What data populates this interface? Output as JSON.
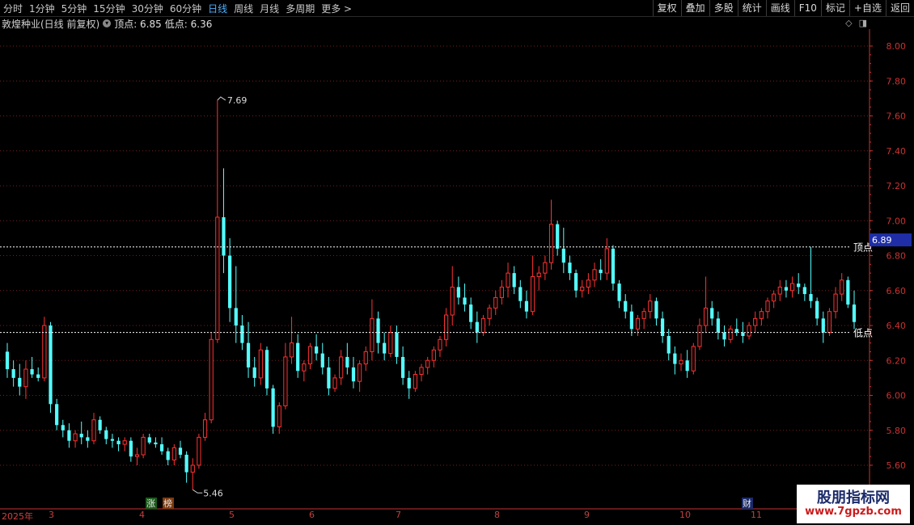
{
  "toolbar": {
    "periods": [
      "分时",
      "1分钟",
      "5分钟",
      "15分钟",
      "30分钟",
      "60分钟",
      "日线",
      "周线",
      "月线",
      "多周期",
      "更多 >"
    ],
    "active": "日线",
    "tools": [
      "复权",
      "叠加",
      "多股",
      "统计",
      "画线",
      "F10",
      "标记",
      "+自选",
      "返回"
    ]
  },
  "info": {
    "title": "敦煌种业(日线 前复权)",
    "dot_icon": "menu-dot-icon",
    "top_label": "顶点: 6.85",
    "low_label": "低点: 6.36"
  },
  "colors": {
    "up": "#ff3232",
    "down": "#54ffff",
    "grid": "#7a1e1e",
    "axis": "#c83232",
    "level_line": "#ffffff",
    "price_tag": "#1f2ea6"
  },
  "chart_data": {
    "type": "candlestick",
    "title": "敦煌种业(日线 前复权)",
    "ylim": [
      5.5,
      8.1
    ],
    "yticks": [
      "8.00",
      "7.80",
      "7.60",
      "7.40",
      "7.20",
      "7.00",
      "6.80",
      "6.60",
      "6.40",
      "6.20",
      "6.00",
      "5.80",
      "5.60"
    ],
    "x_labels": [
      "2025年",
      "3",
      "4",
      "5",
      "6",
      "7",
      "8",
      "9",
      "10",
      "11"
    ],
    "levels": [
      {
        "name": "顶点",
        "value": 6.85
      },
      {
        "name": "低点",
        "value": 6.36
      }
    ],
    "current_price": "6.89",
    "annotations": [
      {
        "text": "7.69",
        "value": 7.69
      },
      {
        "text": "5.46",
        "value": 5.46
      }
    ],
    "markers": [
      "涨",
      "榜",
      "财"
    ],
    "ohlc": [
      [
        6.25,
        6.3,
        6.1,
        6.15
      ],
      [
        6.15,
        6.2,
        6.05,
        6.1
      ],
      [
        6.1,
        6.18,
        6.0,
        6.05
      ],
      [
        6.05,
        6.2,
        5.98,
        6.15
      ],
      [
        6.15,
        6.22,
        6.1,
        6.12
      ],
      [
        6.12,
        6.16,
        6.08,
        6.1
      ],
      [
        6.1,
        6.45,
        6.08,
        6.4
      ],
      [
        6.4,
        6.42,
        5.9,
        5.95
      ],
      [
        5.95,
        5.98,
        5.8,
        5.83
      ],
      [
        5.83,
        5.86,
        5.76,
        5.8
      ],
      [
        5.8,
        5.84,
        5.7,
        5.74
      ],
      [
        5.74,
        5.8,
        5.7,
        5.78
      ],
      [
        5.78,
        5.85,
        5.72,
        5.76
      ],
      [
        5.76,
        5.8,
        5.7,
        5.74
      ],
      [
        5.74,
        5.9,
        5.72,
        5.86
      ],
      [
        5.86,
        5.88,
        5.78,
        5.8
      ],
      [
        5.8,
        5.82,
        5.72,
        5.75
      ],
      [
        5.75,
        5.78,
        5.7,
        5.74
      ],
      [
        5.74,
        5.76,
        5.68,
        5.72
      ],
      [
        5.72,
        5.76,
        5.68,
        5.74
      ],
      [
        5.74,
        5.76,
        5.62,
        5.65
      ],
      [
        5.65,
        5.7,
        5.6,
        5.66
      ],
      [
        5.66,
        5.78,
        5.64,
        5.76
      ],
      [
        5.76,
        5.78,
        5.72,
        5.73
      ],
      [
        5.73,
        5.76,
        5.7,
        5.72
      ],
      [
        5.72,
        5.76,
        5.66,
        5.68
      ],
      [
        5.68,
        5.7,
        5.6,
        5.63
      ],
      [
        5.63,
        5.72,
        5.6,
        5.7
      ],
      [
        5.7,
        5.74,
        5.64,
        5.66
      ],
      [
        5.66,
        5.68,
        5.5,
        5.56
      ],
      [
        5.56,
        5.64,
        5.46,
        5.6
      ],
      [
        5.6,
        5.78,
        5.58,
        5.76
      ],
      [
        5.76,
        5.9,
        5.74,
        5.86
      ],
      [
        5.86,
        6.36,
        5.84,
        6.32
      ],
      [
        6.32,
        7.69,
        6.3,
        7.02
      ],
      [
        7.02,
        7.3,
        6.7,
        6.8
      ],
      [
        6.8,
        6.9,
        6.42,
        6.5
      ],
      [
        6.5,
        6.74,
        6.3,
        6.4
      ],
      [
        6.4,
        6.46,
        6.26,
        6.3
      ],
      [
        6.3,
        6.42,
        6.1,
        6.16
      ],
      [
        6.16,
        6.22,
        6.05,
        6.1
      ],
      [
        6.1,
        6.3,
        6.06,
        6.26
      ],
      [
        6.26,
        6.28,
        6.0,
        6.04
      ],
      [
        6.04,
        6.06,
        5.78,
        5.82
      ],
      [
        5.82,
        5.96,
        5.78,
        5.94
      ],
      [
        5.94,
        6.3,
        5.92,
        6.22
      ],
      [
        6.22,
        6.45,
        6.18,
        6.3
      ],
      [
        6.3,
        6.35,
        6.1,
        6.14
      ],
      [
        6.14,
        6.2,
        6.08,
        6.18
      ],
      [
        6.18,
        6.3,
        6.15,
        6.28
      ],
      [
        6.28,
        6.35,
        6.2,
        6.24
      ],
      [
        6.24,
        6.3,
        6.12,
        6.16
      ],
      [
        6.16,
        6.22,
        6.0,
        6.04
      ],
      [
        6.04,
        6.12,
        6.02,
        6.1
      ],
      [
        6.1,
        6.26,
        6.06,
        6.22
      ],
      [
        6.22,
        6.3,
        6.12,
        6.16
      ],
      [
        6.16,
        6.22,
        6.04,
        6.08
      ],
      [
        6.08,
        6.2,
        6.02,
        6.18
      ],
      [
        6.18,
        6.28,
        6.14,
        6.25
      ],
      [
        6.25,
        6.55,
        6.2,
        6.44
      ],
      [
        6.44,
        6.48,
        6.24,
        6.3
      ],
      [
        6.3,
        6.36,
        6.2,
        6.24
      ],
      [
        6.24,
        6.4,
        6.22,
        6.36
      ],
      [
        6.36,
        6.4,
        6.18,
        6.22
      ],
      [
        6.22,
        6.28,
        6.06,
        6.1
      ],
      [
        6.1,
        6.14,
        5.98,
        6.04
      ],
      [
        6.04,
        6.14,
        6.02,
        6.12
      ],
      [
        6.12,
        6.18,
        6.08,
        6.16
      ],
      [
        6.16,
        6.22,
        6.12,
        6.2
      ],
      [
        6.2,
        6.28,
        6.16,
        6.26
      ],
      [
        6.26,
        6.34,
        6.22,
        6.32
      ],
      [
        6.32,
        6.5,
        6.28,
        6.46
      ],
      [
        6.46,
        6.74,
        6.4,
        6.62
      ],
      [
        6.62,
        6.68,
        6.52,
        6.56
      ],
      [
        6.56,
        6.64,
        6.48,
        6.52
      ],
      [
        6.52,
        6.56,
        6.38,
        6.42
      ],
      [
        6.42,
        6.48,
        6.3,
        6.36
      ],
      [
        6.36,
        6.46,
        6.34,
        6.44
      ],
      [
        6.44,
        6.52,
        6.4,
        6.5
      ],
      [
        6.5,
        6.6,
        6.46,
        6.56
      ],
      [
        6.56,
        6.66,
        6.52,
        6.62
      ],
      [
        6.62,
        6.76,
        6.56,
        6.7
      ],
      [
        6.7,
        6.74,
        6.58,
        6.62
      ],
      [
        6.62,
        6.66,
        6.5,
        6.54
      ],
      [
        6.54,
        6.6,
        6.44,
        6.48
      ],
      [
        6.48,
        6.8,
        6.46,
        6.68
      ],
      [
        6.68,
        6.74,
        6.6,
        6.7
      ],
      [
        6.7,
        6.8,
        6.66,
        6.76
      ],
      [
        6.76,
        7.12,
        6.72,
        6.98
      ],
      [
        6.98,
        7.0,
        6.8,
        6.84
      ],
      [
        6.84,
        6.96,
        6.7,
        6.76
      ],
      [
        6.76,
        6.8,
        6.66,
        6.7
      ],
      [
        6.7,
        6.72,
        6.56,
        6.6
      ],
      [
        6.6,
        6.66,
        6.56,
        6.62
      ],
      [
        6.62,
        6.7,
        6.58,
        6.66
      ],
      [
        6.66,
        6.76,
        6.62,
        6.72
      ],
      [
        6.72,
        6.78,
        6.66,
        6.7
      ],
      [
        6.7,
        6.9,
        6.66,
        6.84
      ],
      [
        6.84,
        6.86,
        6.6,
        6.64
      ],
      [
        6.64,
        6.66,
        6.5,
        6.54
      ],
      [
        6.54,
        6.58,
        6.44,
        6.48
      ],
      [
        6.48,
        6.52,
        6.34,
        6.38
      ],
      [
        6.38,
        6.46,
        6.34,
        6.44
      ],
      [
        6.44,
        6.5,
        6.38,
        6.48
      ],
      [
        6.48,
        6.58,
        6.44,
        6.54
      ],
      [
        6.54,
        6.56,
        6.4,
        6.44
      ],
      [
        6.44,
        6.48,
        6.3,
        6.34
      ],
      [
        6.34,
        6.38,
        6.2,
        6.24
      ],
      [
        6.24,
        6.28,
        6.12,
        6.18
      ],
      [
        6.18,
        6.24,
        6.14,
        6.2
      ],
      [
        6.2,
        6.26,
        6.1,
        6.14
      ],
      [
        6.14,
        6.3,
        6.12,
        6.28
      ],
      [
        6.28,
        6.44,
        6.26,
        6.4
      ],
      [
        6.4,
        6.68,
        6.36,
        6.5
      ],
      [
        6.5,
        6.54,
        6.4,
        6.44
      ],
      [
        6.44,
        6.48,
        6.32,
        6.36
      ],
      [
        6.36,
        6.4,
        6.28,
        6.32
      ],
      [
        6.32,
        6.4,
        6.3,
        6.38
      ],
      [
        6.38,
        6.44,
        6.34,
        6.36
      ],
      [
        6.36,
        6.42,
        6.3,
        6.34
      ],
      [
        6.34,
        6.42,
        6.32,
        6.4
      ],
      [
        6.4,
        6.48,
        6.36,
        6.44
      ],
      [
        6.44,
        6.5,
        6.4,
        6.48
      ],
      [
        6.48,
        6.56,
        6.44,
        6.54
      ],
      [
        6.54,
        6.6,
        6.5,
        6.58
      ],
      [
        6.58,
        6.66,
        6.54,
        6.62
      ],
      [
        6.62,
        6.66,
        6.56,
        6.6
      ],
      [
        6.6,
        6.68,
        6.56,
        6.64
      ],
      [
        6.64,
        6.7,
        6.58,
        6.62
      ],
      [
        6.62,
        6.64,
        6.54,
        6.58
      ],
      [
        6.58,
        6.85,
        6.5,
        6.54
      ],
      [
        6.54,
        6.56,
        6.4,
        6.44
      ],
      [
        6.44,
        6.48,
        6.3,
        6.36
      ],
      [
        6.36,
        6.5,
        6.34,
        6.48
      ],
      [
        6.48,
        6.62,
        6.44,
        6.58
      ],
      [
        6.58,
        6.7,
        6.54,
        6.66
      ],
      [
        6.66,
        6.68,
        6.5,
        6.52
      ],
      [
        6.52,
        6.6,
        6.38,
        6.42
      ]
    ]
  },
  "watermark": {
    "line1": "股朋指标网",
    "line2": "www.7gpzb.com"
  }
}
